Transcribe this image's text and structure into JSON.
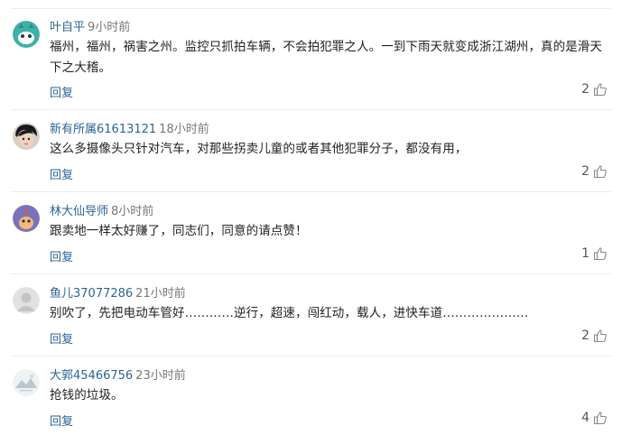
{
  "comments": [
    {
      "user": "叶自平",
      "time": "9小时前",
      "text": "福州，福州，祸害之州。监控只抓拍车辆，不会拍犯罪之人。一到下雨天就变成浙江湖州，真的是滑天下之大稽。",
      "reply": "回复",
      "likes": "2",
      "avatar": "teal-face-avatar"
    },
    {
      "user": "新有所属61613121",
      "time": "18小时前",
      "text": "这么多摄像头只针对汽车，对那些拐卖儿童的或者其他犯罪分子，都没有用，",
      "reply": "回复",
      "likes": "2",
      "avatar": "photo-avatar"
    },
    {
      "user": "林大仙导师",
      "time": "8小时前",
      "text": "跟卖地一样太好赚了，同志们，同意的请点赞！",
      "reply": "回复",
      "likes": "1",
      "avatar": "purple-face-avatar"
    },
    {
      "user": "鱼儿37077286",
      "time": "21小时前",
      "text": "别吹了，先把电动车管好…………逆行，超速，闯红动，载人，进快车道…………………",
      "reply": "回复",
      "likes": "2",
      "avatar": "default-gray-avatar"
    },
    {
      "user": "大郭45466756",
      "time": "23小时前",
      "text": "抢钱的垃圾。",
      "reply": "回复",
      "likes": "4",
      "avatar": "landscape-avatar"
    }
  ],
  "colors": {
    "name": "#2a6496",
    "time": "#777777",
    "divider": "#ececec"
  }
}
